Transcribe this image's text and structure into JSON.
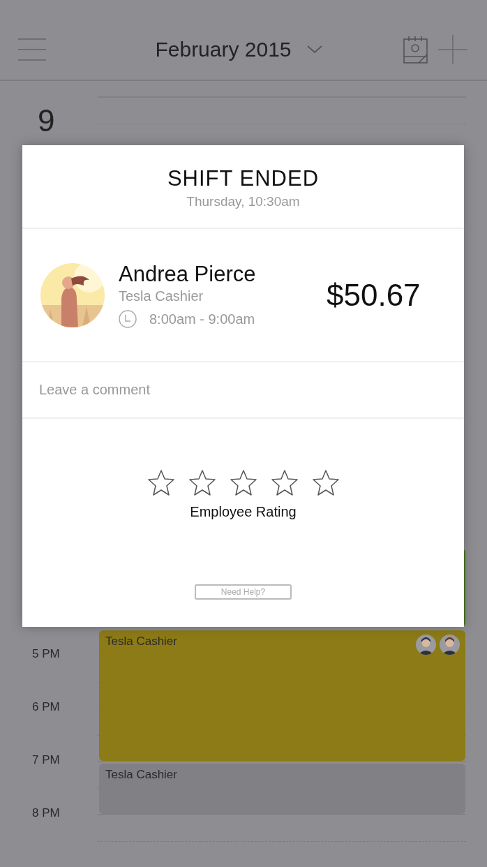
{
  "header": {
    "title": "February 2015"
  },
  "day": {
    "number": "9"
  },
  "hours": [
    "5 PM",
    "6 PM",
    "7 PM",
    "8 PM"
  ],
  "events": [
    {
      "color": "#4b7723"
    },
    {
      "title": "Tesla Cashier",
      "color": "#8c7b16",
      "avatars": [
        {
          "kind": "avatar"
        },
        {
          "kind": "avatar"
        }
      ]
    },
    {
      "title": "Tesla Cashier",
      "color": "#808085"
    }
  ],
  "modal": {
    "title": "SHIFT ENDED",
    "subtitle": "Thursday, 10:30am",
    "employee": {
      "name": "Andrea Pierce",
      "role": "Tesla Cashier",
      "time": "8:00am - 9:00am",
      "amount": "$50.67"
    },
    "comment": {
      "placeholder": "Leave a comment"
    },
    "rating": {
      "stars": 0,
      "label": "Employee Rating"
    },
    "help": "Need Help?"
  }
}
